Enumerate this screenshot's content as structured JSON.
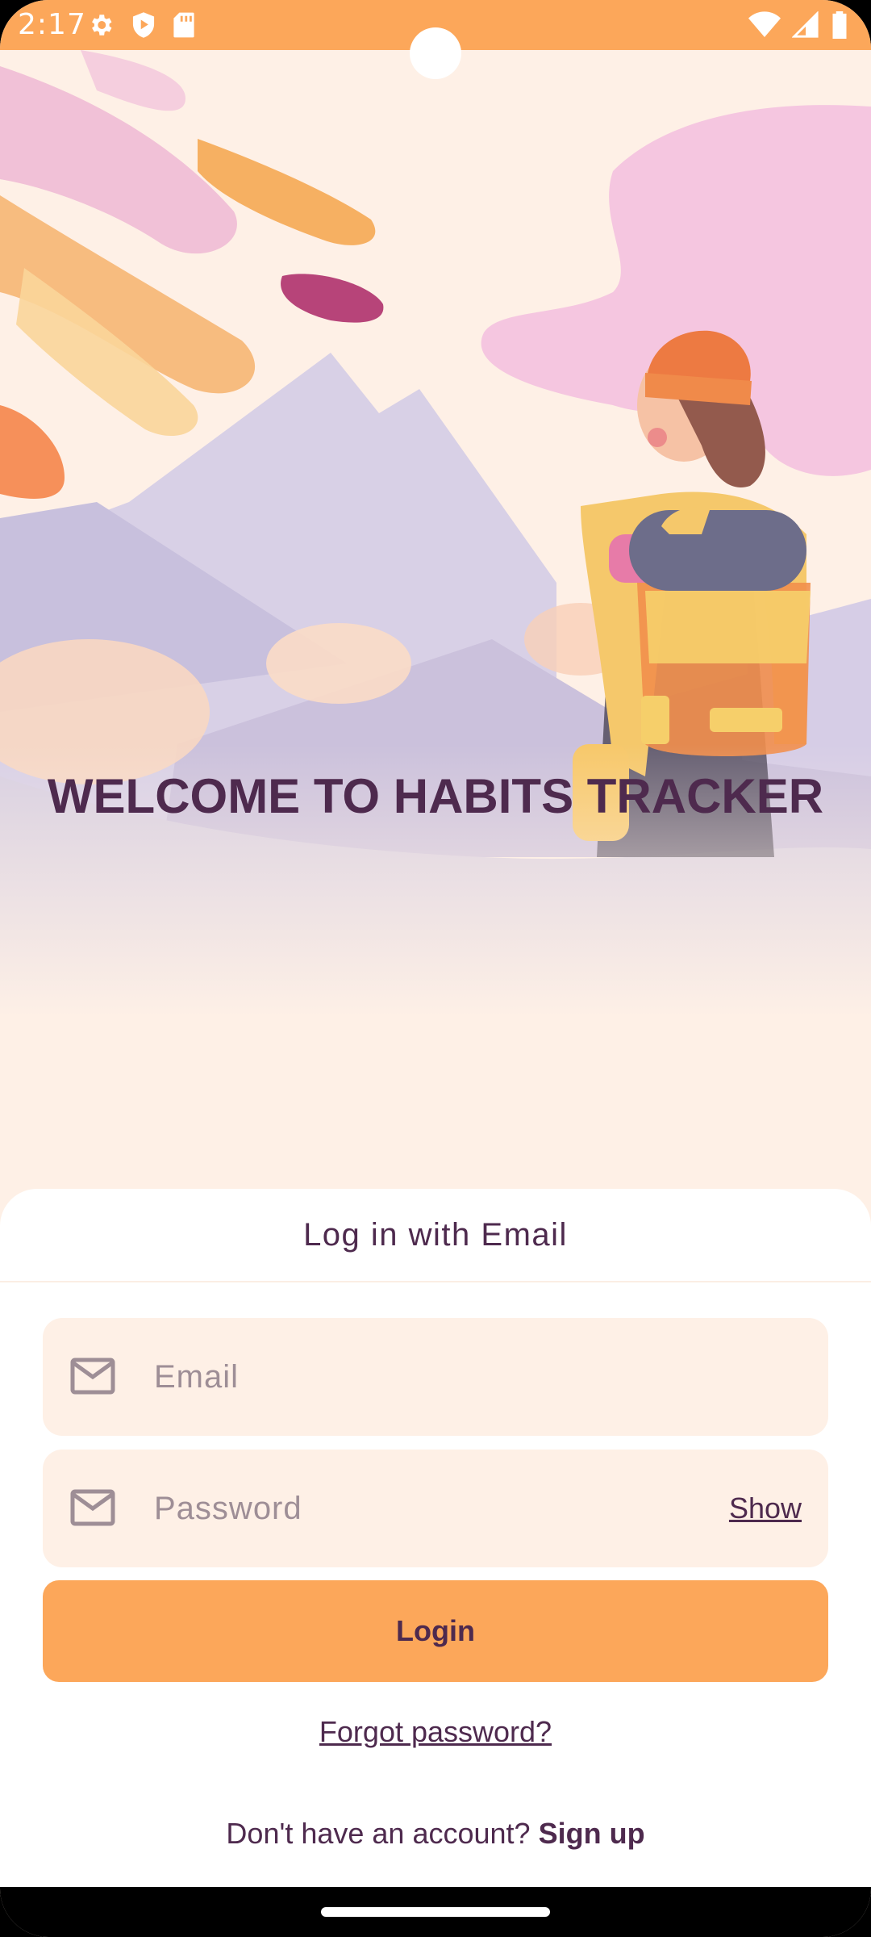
{
  "status_bar": {
    "time": "2:17",
    "left_icons": [
      "settings-gear-icon",
      "shield-play-icon",
      "sd-card-icon"
    ],
    "right_icons": [
      "wifi-icon",
      "cell-signal-icon",
      "battery-icon"
    ],
    "background": "#fca75a"
  },
  "hero": {
    "title": "WELCOME TO HABITS TRACKER",
    "illustration": "hiker-with-backpack-mountains-illustration"
  },
  "login_sheet": {
    "header": "Log in with Email",
    "email_field": {
      "placeholder": "Email",
      "icon": "mail-icon"
    },
    "password_field": {
      "placeholder": "Password",
      "icon": "mail-icon",
      "toggle_label": "Show"
    },
    "login_button": "Login",
    "forgot_password": "Forgot password?",
    "signup_prompt": "Don't have an account?",
    "signup_link": "Sign up"
  },
  "colors": {
    "accent": "#fca75a",
    "text": "#4e2a4e",
    "field_background": "#fef0e6",
    "page_background": "#fef0e6"
  }
}
